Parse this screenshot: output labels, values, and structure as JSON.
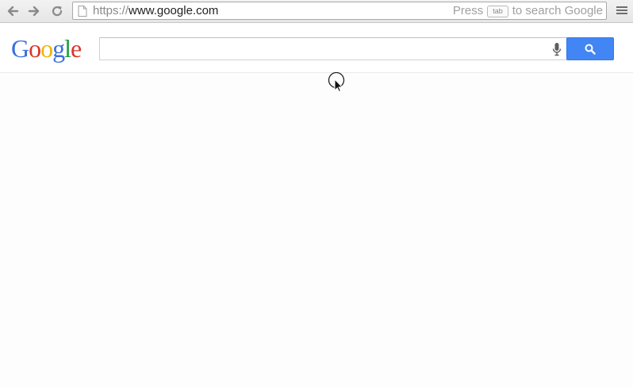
{
  "browser": {
    "url_scheme": "https://",
    "url_host": "www.google.com",
    "hint_prefix": "Press",
    "hint_key": "tab",
    "hint_suffix": "to search Google"
  },
  "icons": {
    "back": "back-arrow-icon",
    "forward": "forward-arrow-icon",
    "reload": "reload-icon",
    "page": "page-icon",
    "menu": "menu-icon",
    "mic": "microphone-icon",
    "search": "magnifier-icon"
  },
  "google": {
    "logo_letters": [
      "G",
      "o",
      "o",
      "g",
      "l",
      "e"
    ],
    "search_value": "",
    "colors": {
      "blue": "#4285f4",
      "red": "#d9372b",
      "yellow": "#f0b400",
      "green": "#1e9e3f"
    }
  }
}
